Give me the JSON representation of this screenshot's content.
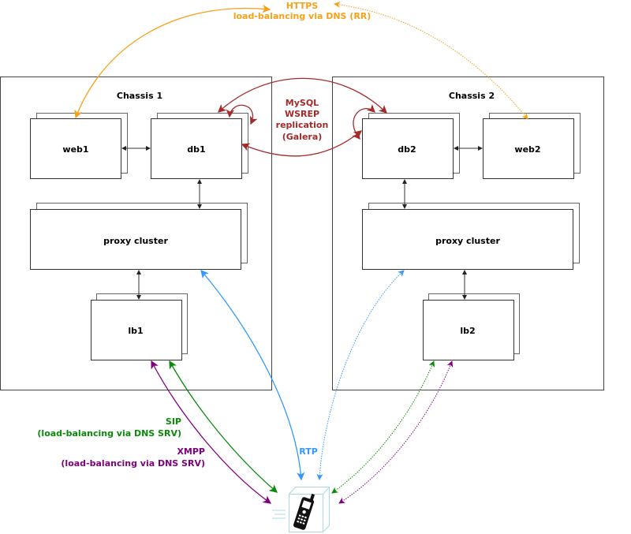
{
  "colors": {
    "https": "#f5a11a",
    "mysql": "#a52a2a",
    "rtp": "#3399ff",
    "sip": "#0a8a0a",
    "xmpp": "#800080",
    "box": "#333333",
    "phone_box": "#a8d8e8"
  },
  "chassis": [
    {
      "title": "Chassis 1",
      "nodes": {
        "web": "web1",
        "db": "db1",
        "proxy": "proxy cluster",
        "lb": "lb1"
      }
    },
    {
      "title": "Chassis 2",
      "nodes": {
        "web": "web2",
        "db": "db2",
        "proxy": "proxy cluster",
        "lb": "lb2"
      }
    }
  ],
  "labels": {
    "https_title": "HTTPS",
    "https_sub": "load-balancing via DNS (RR)",
    "mysql_1": "MySQL",
    "mysql_2": "WSREP",
    "mysql_3": "replication",
    "mysql_4": "(Galera)",
    "sip_title": "SIP",
    "sip_sub": "(load-balancing via DNS SRV)",
    "xmpp_title": "XMPP",
    "xmpp_sub": "(load-balancing via DNS SRV)",
    "rtp": "RTP"
  },
  "client": {
    "icon": "mobile-phone-icon"
  }
}
